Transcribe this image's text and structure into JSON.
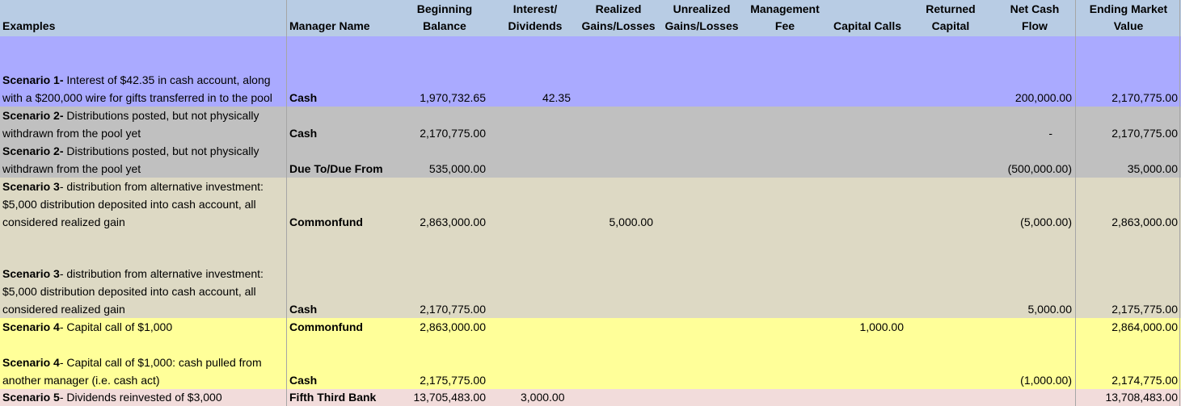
{
  "headers": {
    "examples": "Examples",
    "manager_name": "Manager Name",
    "beginning_balance": [
      "Beginning",
      "Balance"
    ],
    "interest_dividends": [
      "Interest/",
      "Dividends"
    ],
    "realized": [
      "Realized",
      "Gains/Losses"
    ],
    "unrealized": [
      "Unrealized",
      "Gains/Losses"
    ],
    "management_fee": [
      "Management",
      "Fee"
    ],
    "capital_calls": "Capital Calls",
    "returned_capital": [
      "Returned",
      "Capital"
    ],
    "net_cash_flow": [
      "Net Cash",
      "Flow"
    ],
    "ending_market_value": [
      "Ending Market",
      "Value"
    ]
  },
  "rows": [
    {
      "scenario": "Scenario 1-",
      "description": " Interest of $42.35 in cash account, along with a $200,000 wire for gifts transferred in to the pool",
      "manager": "Cash",
      "beginning": "1,970,732.65",
      "interest": "42.35",
      "realized": "",
      "capital_calls": "",
      "net_cash_flow": "200,000.00",
      "ending": "2,170,775.00",
      "color": "#aaaaff"
    },
    {
      "scenario": "Scenario 2-",
      "description": " Distributions posted, but not physically withdrawn from the pool yet",
      "manager": "Cash",
      "beginning": "2,170,775.00",
      "interest": "",
      "realized": "",
      "capital_calls": "",
      "net_cash_flow": "-",
      "ending": "2,170,775.00",
      "color": "#c0c0c0"
    },
    {
      "scenario": "Scenario 2-",
      "description": " Distributions posted, but not physically withdrawn from the pool yet",
      "manager": "Due To/Due From",
      "beginning": "535,000.00",
      "interest": "",
      "realized": "",
      "capital_calls": "",
      "net_cash_flow": "(500,000.00)",
      "ending": "35,000.00",
      "color": "#c0c0c0"
    },
    {
      "scenario": "Scenario 3",
      "description": "- distribution from alternative investment: $5,000 distribution deposited into cash account, all considered realized gain",
      "manager": "Commonfund",
      "beginning": "2,863,000.00",
      "interest": "",
      "realized": "5,000.00",
      "capital_calls": "",
      "net_cash_flow": "(5,000.00)",
      "ending": "2,863,000.00",
      "color": "#ddd9c4"
    },
    {
      "scenario": "Scenario 3",
      "description": "- distribution from alternative investment: $5,000 distribution deposited into cash account, all considered realized gain",
      "manager": "Cash",
      "beginning": "2,170,775.00",
      "interest": "",
      "realized": "",
      "capital_calls": "",
      "net_cash_flow": "5,000.00",
      "ending": "2,175,775.00",
      "color": "#ddd9c4"
    },
    {
      "scenario": "Scenario 4",
      "description": "- Capital call of $1,000",
      "manager": "Commonfund",
      "beginning": "2,863,000.00",
      "interest": "",
      "realized": "",
      "capital_calls": "1,000.00",
      "net_cash_flow": "",
      "ending": "2,864,000.00",
      "color": "#ffff99"
    },
    {
      "scenario": "Scenario 4",
      "description": "- Capital call of $1,000: cash pulled from another manager (i.e. cash act)",
      "manager": "Cash",
      "beginning": "2,175,775.00",
      "interest": "",
      "realized": "",
      "capital_calls": "",
      "net_cash_flow": "(1,000.00)",
      "ending": "2,174,775.00",
      "color": "#ffff99"
    },
    {
      "scenario": "Scenario 5",
      "description": "- Dividends reinvested of $3,000",
      "manager": "Fifth Third Bank",
      "beginning": "13,705,483.00",
      "interest": "3,000.00",
      "realized": "",
      "capital_calls": "",
      "net_cash_flow": "",
      "ending": "13,708,483.00",
      "color": "#f2dcdb"
    }
  ]
}
